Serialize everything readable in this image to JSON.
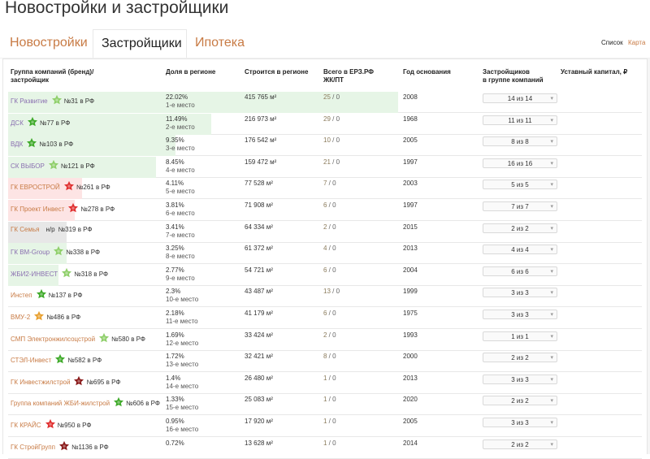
{
  "page": {
    "title": "Новостройки и застройщики"
  },
  "tabs": [
    {
      "label": "Новостройки",
      "active": false
    },
    {
      "label": "Застройщики",
      "active": true
    },
    {
      "label": "Ипотека",
      "active": false
    }
  ],
  "view": {
    "list_label": "Список",
    "map_label": "Карта"
  },
  "headers": {
    "group": "Группа компаний (бренд)/\nзастройщик",
    "share": "Доля в регионе",
    "build": "Строится в регионе",
    "erz": "Всего в ЕРЗ.РФ\nЖК/ПТ",
    "year": "Год основания",
    "count": "Застройщиков\nв группе компаний",
    "capital": "Уставный капитал, ₽"
  },
  "colors": {
    "accent": "#c87b45",
    "green_bar": "#e6f5e6",
    "red_bar": "#fde4e4",
    "gray_bar": "#e7e7e7",
    "star_green": "#3faa2a",
    "star_light_green": "#8fcf6a",
    "star_red": "#e03030",
    "star_orange": "#e8a030",
    "star_dark_red": "#8a1a1a"
  },
  "rows": [
    {
      "name": "ГК Развитие",
      "name_color": "purple",
      "star": "star-light-green-icon",
      "star_color": "#8fcf6a",
      "rank": "№31 в РФ",
      "share": "22.02%",
      "place": "1-е место",
      "bar": "green",
      "bar_pct": 100,
      "build": "415 765 м²",
      "erz1": "25",
      "erz2": "0",
      "year": "2008",
      "count": "14 из 14"
    },
    {
      "name": "ДСК",
      "name_color": "purple",
      "star": "star-green-icon",
      "star_color": "#3faa2a",
      "rank": "№77 в РФ",
      "share": "11.49%",
      "place": "2-е место",
      "bar": "green",
      "bar_pct": 52,
      "build": "216 973 м²",
      "erz1": "29",
      "erz2": "0",
      "year": "1968",
      "count": "11 из 11"
    },
    {
      "name": "ВДК",
      "name_color": "purple",
      "star": "star-green-icon",
      "star_color": "#3faa2a",
      "rank": "№103 в РФ",
      "share": "9.35%",
      "place": "3-е место",
      "bar": "green",
      "bar_pct": 43,
      "build": "176 542 м²",
      "erz1": "10",
      "erz2": "0",
      "year": "2005",
      "count": "8 из 8"
    },
    {
      "name": "СК ВЫБОР",
      "name_color": "purple",
      "star": "star-light-green-icon",
      "star_color": "#8fcf6a",
      "rank": "№121 в РФ",
      "share": "8.45%",
      "place": "4-е место",
      "bar": "green",
      "bar_pct": 38,
      "build": "159 472 м²",
      "erz1": "21",
      "erz2": "0",
      "year": "1997",
      "count": "16 из 16"
    },
    {
      "name": "ГК ЕВРОСТРОЙ",
      "name_color": "orange",
      "star": "star-red-icon",
      "star_color": "#e03030",
      "rank": "№261 в РФ",
      "share": "4.11%",
      "place": "5-е место",
      "bar": "red",
      "bar_pct": 19,
      "build": "77 528 м²",
      "erz1": "7",
      "erz2": "0",
      "year": "2003",
      "count": "5 из 5"
    },
    {
      "name": "ГК Проект Инвест",
      "name_color": "orange",
      "star": "star-red-icon",
      "star_color": "#e03030",
      "rank": "№278 в РФ",
      "share": "3.81%",
      "place": "6-е место",
      "bar": "red",
      "bar_pct": 17,
      "build": "71 908 м²",
      "erz1": "6",
      "erz2": "0",
      "year": "1997",
      "count": "7 из 7"
    },
    {
      "name": "ГК Семья",
      "name_color": "orange",
      "star": "",
      "star_color": "",
      "rank_prefix": "н/р",
      "rank": "№319 в РФ",
      "share": "3.41%",
      "place": "7-е место",
      "bar": "gray",
      "bar_pct": 15,
      "build": "64 334 м²",
      "erz1": "2",
      "erz2": "0",
      "year": "2015",
      "count": "2 из 2"
    },
    {
      "name": "ГК ВМ-Group",
      "name_color": "purple",
      "star": "star-light-green-icon",
      "star_color": "#8fcf6a",
      "rank": "№338 в РФ",
      "share": "3.25%",
      "place": "8-е место",
      "bar": "green",
      "bar_pct": 15,
      "build": "61 372 м²",
      "erz1": "4",
      "erz2": "0",
      "year": "2013",
      "count": "4 из 4"
    },
    {
      "name": "ЖБИ2-ИНВЕСТ",
      "name_color": "purple",
      "star": "star-light-green-icon",
      "star_color": "#8fcf6a",
      "rank": "№318 в РФ",
      "share": "2.77%",
      "place": "9-е место",
      "bar": "green",
      "bar_pct": 13,
      "build": "54 721 м²",
      "erz1": "6",
      "erz2": "0",
      "year": "2004",
      "count": "6 из 6"
    },
    {
      "name": "Инстеп",
      "name_color": "orange",
      "star": "star-green-icon",
      "star_color": "#3faa2a",
      "rank": "№137 в РФ",
      "share": "2.3%",
      "place": "10-е место",
      "bar": "none",
      "bar_pct": 0,
      "build": "43 487 м²",
      "erz1": "13",
      "erz2": "0",
      "year": "1999",
      "count": "3 из 3"
    },
    {
      "name": "ВМУ-2",
      "name_color": "orange",
      "star": "star-orange-icon",
      "star_color": "#e8a030",
      "rank": "№486 в РФ",
      "share": "2.18%",
      "place": "11-е место",
      "bar": "none",
      "bar_pct": 0,
      "build": "41 179 м²",
      "erz1": "6",
      "erz2": "0",
      "year": "1975",
      "count": "3 из 3"
    },
    {
      "name": "СМП Электронжилсоцстрой",
      "name_color": "orange",
      "star": "star-light-green-icon",
      "star_color": "#8fcf6a",
      "rank": "№580 в РФ",
      "share": "1.69%",
      "place": "12-е место",
      "bar": "none",
      "bar_pct": 0,
      "build": "33 424 м²",
      "erz1": "2",
      "erz2": "0",
      "year": "1993",
      "count": "1 из 1"
    },
    {
      "name": "СТЭЛ-Инвест",
      "name_color": "orange",
      "star": "star-green-icon",
      "star_color": "#3faa2a",
      "rank": "№582 в РФ",
      "share": "1.72%",
      "place": "13-е место",
      "bar": "none",
      "bar_pct": 0,
      "build": "32 421 м²",
      "erz1": "8",
      "erz2": "0",
      "year": "2000",
      "count": "2 из 2"
    },
    {
      "name": "ГК Инвестжилстрой",
      "name_color": "orange",
      "star": "star-dark-red-icon",
      "star_color": "#8a1a1a",
      "rank": "№695 в РФ",
      "share": "1.4%",
      "place": "14-е место",
      "bar": "none",
      "bar_pct": 0,
      "build": "26 480 м²",
      "erz1": "1",
      "erz2": "0",
      "year": "2013",
      "count": "3 из 3"
    },
    {
      "name": "Группа компаний ЖБИ-жилстрой",
      "name_color": "orange",
      "star": "star-green-icon",
      "star_color": "#3faa2a",
      "rank": "№606 в РФ",
      "share": "1.33%",
      "place": "15-е место",
      "bar": "none",
      "bar_pct": 0,
      "build": "25 083 м²",
      "erz1": "1",
      "erz2": "0",
      "year": "2020",
      "count": "2 из 2"
    },
    {
      "name": "ГК КРАЙС",
      "name_color": "orange",
      "star": "star-red-icon",
      "star_color": "#e03030",
      "rank": "№950 в РФ",
      "share": "0.95%",
      "place": "16-е место",
      "bar": "none",
      "bar_pct": 0,
      "build": "17 920 м²",
      "erz1": "1",
      "erz2": "0",
      "year": "2005",
      "count": "3 из 3"
    },
    {
      "name": "ГК СтройГрупп",
      "name_color": "orange",
      "star": "star-dark-red-icon",
      "star_color": "#8a1a1a",
      "rank": "№1136 в РФ",
      "share": "0.72%",
      "place": "",
      "bar": "none",
      "bar_pct": 0,
      "build": "13 628 м²",
      "erz1": "1",
      "erz2": "0",
      "year": "2014",
      "count": "2 из 2"
    }
  ]
}
